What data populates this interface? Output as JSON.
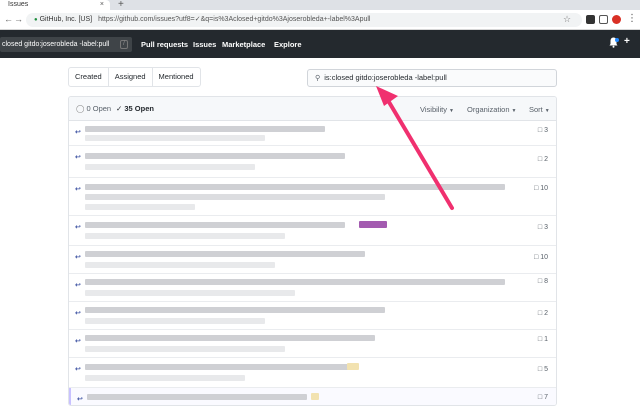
{
  "browser": {
    "tab_title": "Issues",
    "tab_close": "×",
    "new_tab": "+",
    "back": "←",
    "forward": "→",
    "reload": "C",
    "org": "GitHub, Inc. [US]",
    "url": "https://github.com/issues?utf8=✓&q=is%3Aclosed+gitdo%3Ajoserobleda+-label%3Apull",
    "star": "☆",
    "menu": "⋮"
  },
  "header": {
    "search_value": "closed gitdo:joserobleda -label:pull",
    "search_shortcut": "/",
    "nav": [
      "Pull requests",
      "Issues",
      "Marketplace",
      "Explore"
    ],
    "bell": "🔔",
    "plus": "+"
  },
  "filters": {
    "tabs": [
      "Created",
      "Assigned",
      "Mentioned"
    ],
    "query": "is:closed gitdo:joserobleda -label:pull"
  },
  "list": {
    "open_label": "0 Open",
    "closed_label": "✓ 35 Open",
    "dropdowns": [
      "Visibility",
      "Organization",
      "Sort"
    ],
    "caret": "▼",
    "comment_icon": "comment-icon",
    "rows": [
      {
        "comments": "3"
      },
      {
        "comments": "2"
      },
      {
        "comments": "10"
      },
      {
        "comments": "3"
      },
      {
        "comments": "10"
      },
      {
        "comments": "8"
      },
      {
        "comments": "2"
      },
      {
        "comments": "1"
      },
      {
        "comments": "5"
      },
      {
        "comments": "7"
      }
    ]
  },
  "colors": {
    "header_bg": "#24292e",
    "arrow": "#f0306f",
    "pr_icon": "#3a4fa0"
  }
}
